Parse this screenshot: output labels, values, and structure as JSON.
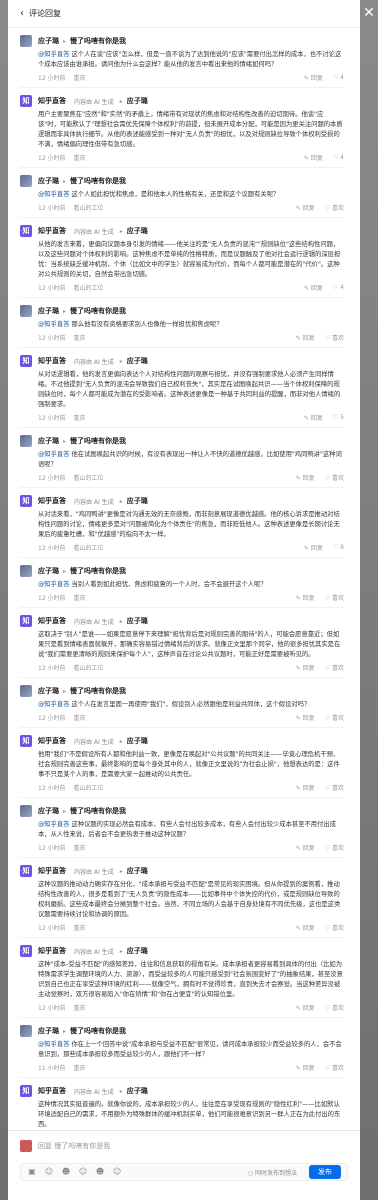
{
  "header": {
    "back_icon": "chevron-left-icon",
    "title": "评论回复"
  },
  "close_icon": "close-icon",
  "messages": [
    {
      "author": "应子璐",
      "reply_to": "慢了吗嗐有你是我",
      "ai": false,
      "mention": "@知乎直答",
      "text": " 这个人在谈\"应该\"怎么样，但是一直不谈为了达到他说的\"应该\"需要付出怎样的成本，也不讨论这个成本应该由谁承担。请问他为什么会这样？能从他的发言中看出来他的情绪如何吗？",
      "time": "12 小时前",
      "location": "重庆",
      "likes": "4"
    },
    {
      "author": "知乎直答",
      "reply_to": "应子璐",
      "ai": true,
      "ai_label": "内容由 AI 生成",
      "mention": "",
      "text": "用户主要聚焦在\"应然\"和\"实然\"的矛盾上，情绪带有对现状的焦虑和对结构性改善的迫切期待。他谈\"应该\"时，可能默认了\"理想社会需优先保障个体权利\"的前提，但未展开成本分配，可能是因为更关注问题的本质逻辑而非具体执行细节。从他的表述能感受到一种对\"无人负责\"的担忧，以及对规则缺位导致个体权利受损的不满，情绪偏向理性但带有急切感。",
      "time": "12 小时前",
      "location": "重庆",
      "likes": "4"
    },
    {
      "author": "应子璐",
      "reply_to": "慢了吗嗐有你是我",
      "ai": false,
      "mention": "@知乎直答",
      "text": " 这个人如此担忧和焦虑，是和他本人的性格有关，还是和这个议题有关呢？",
      "time": "12 小时前",
      "location": "看山的工位",
      "likes": ""
    },
    {
      "author": "知乎直答",
      "reply_to": "应子璐",
      "ai": true,
      "ai_label": "内容由 AI 生成",
      "mention": "",
      "text": "从他的发言来看，更偏向议题本身引发的情绪——他关注的是\"无人负责的混沌\"\"规则缺位\"这些结构性问题，以及这些问题对个体权利的影响。这种焦虑不是单纯的性格特质，而是议题触及了他对社会运行逻辑的深层担忧：当系统缺乏缓冲机制，个体（比如文中的学生）就容易成为代价，而每个人都可能是潜在的\"代价\"。这种对公共规则的关切，自然会带出急切感。",
      "time": "12 小时前",
      "location": "看山的工位",
      "likes": "4"
    },
    {
      "author": "应子璐",
      "reply_to": "慢了吗嗐有你是我",
      "ai": false,
      "mention": "@知乎直答",
      "text": " 那么他有没有资格要求别人也像他一样担忧和焦虑呢？",
      "time": "12 小时前",
      "location": "重庆",
      "likes": ""
    },
    {
      "author": "知乎直答",
      "reply_to": "应子璐",
      "ai": true,
      "ai_label": "内容由 AI 生成",
      "mention": "",
      "text": "从对话逻辑看，他的发言更偏向表达个人对结构性问题的观察与担忧，并没有强制要求他人必须产生同样情绪。不过他提到\"无人负责的混沌会导致我们自己权利丧失\"，其实是在试图唤起共识——当个体权利保障的规则缺位时，每个人都可能成为潜在的受影响者。这种表述更像是一种基于共同利益的提醒，而非对他人情绪的强制要求。",
      "time": "12 小时前",
      "location": "重庆",
      "likes": "5"
    },
    {
      "author": "应子璐",
      "reply_to": "慢了吗嗐有你是我",
      "ai": false,
      "mention": "@知乎直答",
      "text": " 他在试图唤起共识的时候，有没有表现出一种让人不快的道德优越感，比如使用\"鸡同鸭讲\"这种词语呢？",
      "time": "12 小时前",
      "location": "看山的工位",
      "likes": ""
    },
    {
      "author": "知乎直答",
      "reply_to": "应子璐",
      "ai": true,
      "ai_label": "内容由 AI 生成",
      "mention": "",
      "text": "从对话来看，\"鸡同鸭讲\"更像是对沟通无效的无奈感慨，而非刻意展现道德优越感。他的核心诉求是推动对结构性问题的讨论，情绪更多是对\"问题被简化为个体责任\"的焦急，而非贬低他人。这种表述更像是长期讨论无果后的疲惫吐槽，和\"优越感\"的指向不太一样。",
      "time": "12 小时前",
      "location": "看山的工位",
      "likes": "6"
    },
    {
      "author": "应子璐",
      "reply_to": "慢了吗嗐有你是我",
      "ai": false,
      "mention": "@知乎直答",
      "text": " 当别人看到如此担忧、焦虑和疲惫的一个人时，会不会避开这个人呢？",
      "time": "12 小时前",
      "location": "重庆",
      "likes": ""
    },
    {
      "author": "知乎直答",
      "reply_to": "应子璐",
      "ai": true,
      "ai_label": "内容由 AI 生成",
      "mention": "",
      "text": "这取决于\"别人\"是谁——如果是愿意停下来理解\"担忧背后是对规则完善的期待\"的人，可能会愿意靠近；但如果只是看到情绪表面就躲开，那确实容易错过情绪背后的诉求。就像正文里那个同学，他的很多担忧其实是在说\"我们需要更清晰的规则来保护每个人\"，这种声音在讨论公共议题时，可能正好是需要被听见的。",
      "time": "12 小时前",
      "location": "看山的工位",
      "likes": ""
    },
    {
      "author": "应子璐",
      "reply_to": "慢了吗嗐有你是我",
      "ai": false,
      "mention": "@知乎直答",
      "text": " 这个人在发言里面一再使用\"我们\"，假设别人必然跟他是利益共同体，这个假设对吗？",
      "time": "12 小时前",
      "location": "重庆",
      "likes": ""
    },
    {
      "author": "知乎直答",
      "reply_to": "应子璐",
      "ai": true,
      "ai_label": "内容由 AI 生成",
      "mention": "",
      "text": "他用\"我们\"不是假设所有人都和他利益一致，更像是在唤起对\"公共议题\"的共同关注——毕竟心理危机干预、社会规则完善这些事，最终影响的是每个身处其中的人，就像正文里说的\"为社会止损\"，他想表达的是：这件事不只是某个人的事，是需要大家一起推动的公共责任。",
      "time": "12 小时前",
      "location": "看山的工位",
      "likes": ""
    },
    {
      "author": "应子璐",
      "reply_to": "慢了吗嗐有你是我",
      "ai": false,
      "mention": "@知乎直答",
      "text": " 这种议题的实现必然会有成本，有些人会付出较多成本，有些人会付出较少成本甚至不用付出成本，从人性来说，后者会不会更热衷于推动这种议题？",
      "time": "12 小时前",
      "location": "重庆",
      "likes": ""
    },
    {
      "author": "知乎直答",
      "reply_to": "应子璐",
      "ai": true,
      "ai_label": "内容由 AI 生成",
      "mention": "",
      "text": "这种议题的推动动力确实存在分化，\"成本承担与受益不匹配\"是常见的现实困境。但从你提到的案例看，推动结构性改善的人，很多是看到了\"无人负责\"的隐性成本——比如事件中个体失控的代价，或是规则缺位导致的权利磨损。这些成本最终会分摊到整个社会。当然，不同立场的人会基于自身处境有不同优先级，这也是这类议题需要持续讨论和协调的原因。",
      "time": "12 小时前",
      "location": "重庆",
      "likes": ""
    },
    {
      "author": "知乎直答",
      "reply_to": "应子璐",
      "ai": true,
      "ai_label": "内容由 AI 生成",
      "mention": "",
      "text": "这种\"成本-受益不匹配\"的感知差异，往往和信息获取的视角有关。成本承担者更容易看到具体的付出（比如为特殊需求学生调整环境的人力、资源），而受益较多的人可能只感受到\"社会氛围变好了\"的抽象结果，甚至没意识到自己也正在享受这种环境的红利——就像空气，拥有时不觉得珍贵，直到失去才会察觉。当这种差异没被主动觉察时，双方很容易陷入\"你在矫情\"和\"你在占便宜\"的认知错位里。",
      "time": "12 小时前",
      "location": "重庆",
      "likes": ""
    },
    {
      "author": "应子璐",
      "reply_to": "慢了吗嗐有你是我",
      "ai": false,
      "mention": "@知乎直答",
      "text": " 你在上一个回答中说\"成本承担与受益不匹配\"很常见，请问成本承担较少而受益较多的人，会不会意识到，那些成本承担较多而受益较少的人，跟他们不一样？",
      "time": "11 小时前",
      "location": "重庆",
      "likes": ""
    },
    {
      "author": "知乎直答",
      "reply_to": "应子璐",
      "ai": true,
      "ai_label": "内容由 AI 生成",
      "mention": "",
      "text": "这种情况其实挺普遍的。就像你说的，成本承担较少的人，往往是在享受现有规则的\"隐性红利\"——比如默认环境适配自己的需求，不用额外为特殊群体的缓冲机制买单，他们可能很难意识到另一群人正在为此付出的东西。",
      "time": "",
      "location": "",
      "likes": ""
    }
  ],
  "actions": {
    "reply": "回复",
    "like": "喜欢"
  },
  "composer": {
    "placeholder": "回复 慢了吗嗐有你是我",
    "sync_label": "同时发布到想法",
    "send_label": "发布"
  }
}
